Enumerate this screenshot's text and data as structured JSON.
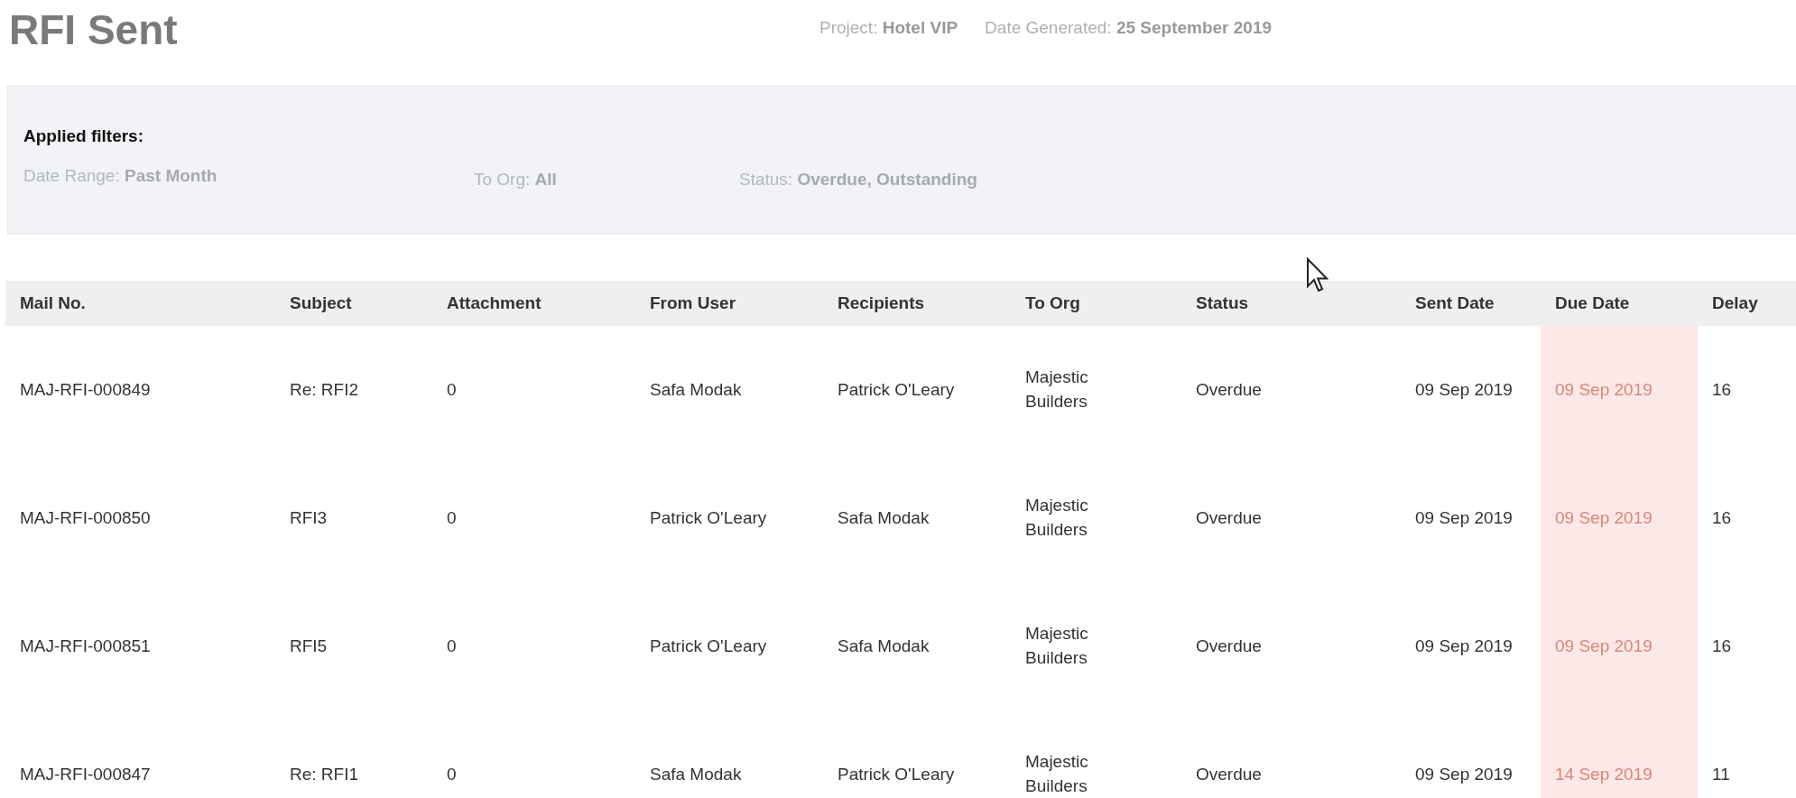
{
  "title": "RFI Sent",
  "meta": [
    {
      "label": "Project:",
      "value": "Hotel VIP"
    },
    {
      "label": "Date Generated:",
      "value": "25 September 2019"
    }
  ],
  "filters": {
    "heading": "Applied filters:",
    "items": [
      {
        "label": "Date Range:",
        "value": "Past Month"
      },
      {
        "label": "To Org:",
        "value": "All"
      },
      {
        "label": "Status:",
        "value": "Overdue, Outstanding"
      }
    ]
  },
  "table": {
    "columns": [
      "Mail No.",
      "Subject",
      "Attachment",
      "From User",
      "Recipients",
      "To Org",
      "Status",
      "Sent Date",
      "Due Date",
      "Delay"
    ],
    "rows": [
      {
        "mail_no": "MAJ-RFI-000849",
        "subject": "Re: RFI2",
        "attachment": "0",
        "from_user": "Safa Modak",
        "recipients": "Patrick O'Leary",
        "to_org": [
          "Majestic",
          "Builders"
        ],
        "status": "Overdue",
        "sent_date": "09 Sep 2019",
        "due_date": "09 Sep 2019",
        "overdue": true,
        "delay": "16"
      },
      {
        "mail_no": "MAJ-RFI-000850",
        "subject": "RFI3",
        "attachment": "0",
        "from_user": "Patrick O'Leary",
        "recipients": "Safa Modak",
        "to_org": [
          "Majestic",
          "Builders"
        ],
        "status": "Overdue",
        "sent_date": "09 Sep 2019",
        "due_date": "09 Sep 2019",
        "overdue": true,
        "delay": "16"
      },
      {
        "mail_no": "MAJ-RFI-000851",
        "subject": "RFI5",
        "attachment": "0",
        "from_user": "Patrick O'Leary",
        "recipients": "Safa Modak",
        "to_org": [
          "Majestic",
          "Builders"
        ],
        "status": "Overdue",
        "sent_date": "09 Sep 2019",
        "due_date": "09 Sep 2019",
        "overdue": true,
        "delay": "16"
      },
      {
        "mail_no": "MAJ-RFI-000847",
        "subject": "Re: RFI1",
        "attachment": "0",
        "from_user": "Safa Modak",
        "recipients": "Patrick O'Leary",
        "to_org": [
          "Majestic",
          "Builders"
        ],
        "status": "Overdue",
        "sent_date": "09 Sep 2019",
        "due_date": "14 Sep 2019",
        "overdue": true,
        "delay": "11"
      }
    ]
  }
}
